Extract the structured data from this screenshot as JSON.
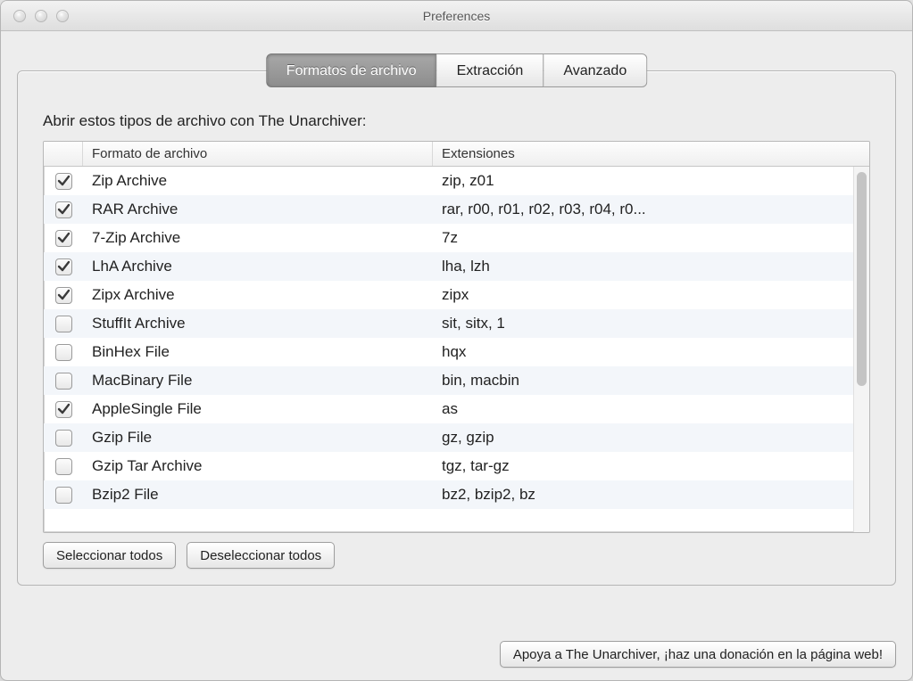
{
  "window": {
    "title": "Preferences"
  },
  "tabs": [
    {
      "label": "Formatos de archivo",
      "active": true
    },
    {
      "label": "Extracción",
      "active": false
    },
    {
      "label": "Avanzado",
      "active": false
    }
  ],
  "intro": "Abrir estos tipos de archivo con The Unarchiver:",
  "columns": {
    "name": "Formato de archivo",
    "ext": "Extensiones"
  },
  "rows": [
    {
      "checked": true,
      "name": "Zip Archive",
      "ext": "zip, z01"
    },
    {
      "checked": true,
      "name": "RAR Archive",
      "ext": "rar, r00, r01, r02, r03, r04, r0..."
    },
    {
      "checked": true,
      "name": "7-Zip Archive",
      "ext": "7z"
    },
    {
      "checked": true,
      "name": "LhA Archive",
      "ext": "lha, lzh"
    },
    {
      "checked": true,
      "name": "Zipx Archive",
      "ext": "zipx"
    },
    {
      "checked": false,
      "name": "StuffIt Archive",
      "ext": "sit, sitx, 1"
    },
    {
      "checked": false,
      "name": "BinHex File",
      "ext": "hqx"
    },
    {
      "checked": false,
      "name": "MacBinary File",
      "ext": "bin, macbin"
    },
    {
      "checked": true,
      "name": "AppleSingle File",
      "ext": "as"
    },
    {
      "checked": false,
      "name": "Gzip File",
      "ext": "gz, gzip"
    },
    {
      "checked": false,
      "name": "Gzip Tar Archive",
      "ext": "tgz, tar-gz"
    },
    {
      "checked": false,
      "name": "Bzip2 File",
      "ext": "bz2, bzip2, bz"
    }
  ],
  "buttons": {
    "select_all": "Seleccionar todos",
    "deselect_all": "Deseleccionar todos",
    "donate": "Apoya a The Unarchiver, ¡haz una donación en la página web!"
  }
}
